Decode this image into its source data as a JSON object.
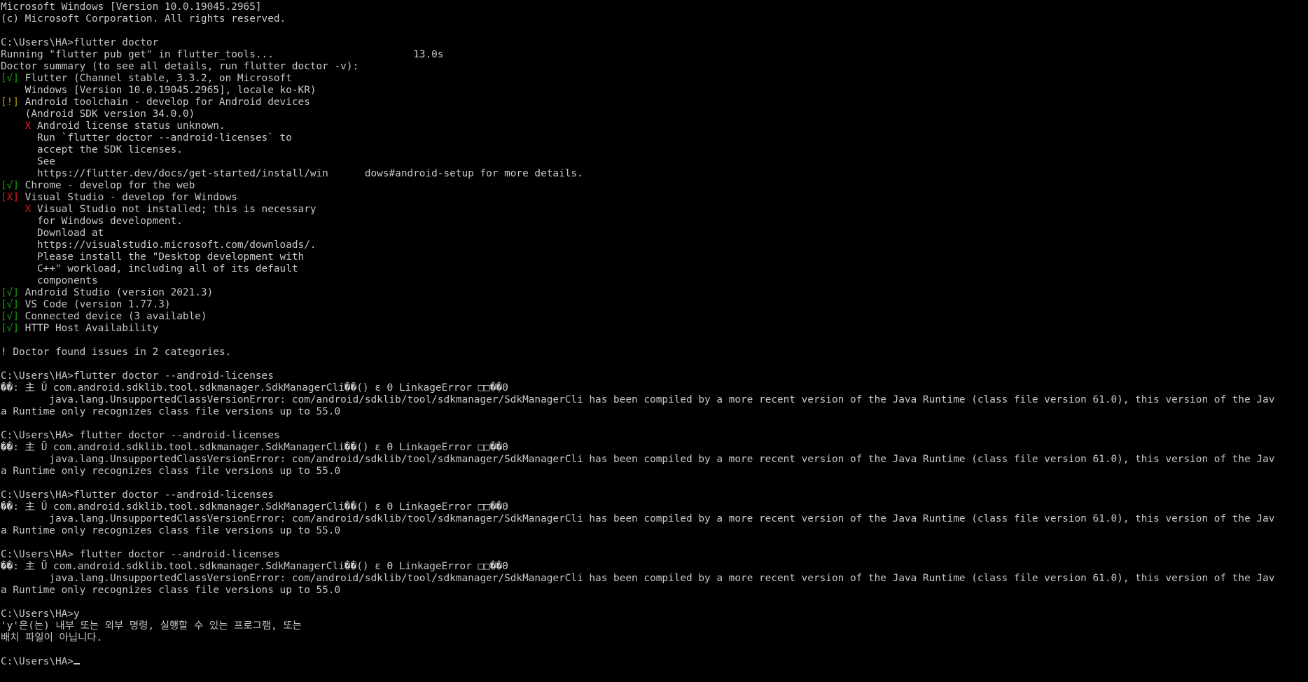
{
  "window": {
    "background": "#000000",
    "foreground": "#c8c8c8",
    "status_colors": {
      "ok": "#13a10e",
      "warning": "#c19c00",
      "error": "#e0181e"
    }
  },
  "console": {
    "lines": [
      {
        "parts": [
          {
            "t": "Microsoft Windows [Version 10.0.19045.2965]"
          }
        ]
      },
      {
        "parts": [
          {
            "t": "(c) Microsoft Corporation. All rights reserved."
          }
        ]
      },
      {
        "parts": [
          {
            "t": ""
          }
        ]
      },
      {
        "parts": [
          {
            "t": "C:\\Users\\HA>flutter doctor"
          }
        ]
      },
      {
        "parts": [
          {
            "t": "Running \"flutter pub get\" in flutter_tools...                       13.0s"
          }
        ]
      },
      {
        "parts": [
          {
            "t": "Doctor summary (to see all details, run flutter doctor -v):"
          }
        ]
      },
      {
        "parts": [
          {
            "t": "[√]",
            "c": "green"
          },
          {
            "t": " Flutter (Channel stable, 3.3.2, on Microsoft"
          }
        ]
      },
      {
        "parts": [
          {
            "t": "    Windows [Version 10.0.19045.2965], locale ko-KR)"
          }
        ]
      },
      {
        "parts": [
          {
            "t": "[!]",
            "c": "yellow"
          },
          {
            "t": " Android toolchain - develop for Android devices"
          }
        ]
      },
      {
        "parts": [
          {
            "t": "    (Android SDK version 34.0.0)"
          }
        ]
      },
      {
        "parts": [
          {
            "t": "    "
          },
          {
            "t": "X",
            "c": "red"
          },
          {
            "t": " Android license status unknown."
          }
        ]
      },
      {
        "parts": [
          {
            "t": "      Run `flutter doctor --android-licenses` to"
          }
        ]
      },
      {
        "parts": [
          {
            "t": "      accept the SDK licenses."
          }
        ]
      },
      {
        "parts": [
          {
            "t": "      See"
          }
        ]
      },
      {
        "parts": [
          {
            "t": "      https://flutter.dev/docs/get-started/install/win      dows#android-setup for more details."
          }
        ]
      },
      {
        "parts": [
          {
            "t": "[√]",
            "c": "green"
          },
          {
            "t": " Chrome - develop for the web"
          }
        ]
      },
      {
        "parts": [
          {
            "t": "[X]",
            "c": "red"
          },
          {
            "t": " Visual Studio - develop for Windows"
          }
        ]
      },
      {
        "parts": [
          {
            "t": "    "
          },
          {
            "t": "X",
            "c": "red"
          },
          {
            "t": " Visual Studio not installed; this is necessary"
          }
        ]
      },
      {
        "parts": [
          {
            "t": "      for Windows development."
          }
        ]
      },
      {
        "parts": [
          {
            "t": "      Download at"
          }
        ]
      },
      {
        "parts": [
          {
            "t": "      https://visualstudio.microsoft.com/downloads/."
          }
        ]
      },
      {
        "parts": [
          {
            "t": "      Please install the \"Desktop development with"
          }
        ]
      },
      {
        "parts": [
          {
            "t": "      C++\" workload, including all of its default"
          }
        ]
      },
      {
        "parts": [
          {
            "t": "      components"
          }
        ]
      },
      {
        "parts": [
          {
            "t": "[√]",
            "c": "green"
          },
          {
            "t": " Android Studio (version 2021.3)"
          }
        ]
      },
      {
        "parts": [
          {
            "t": "[√]",
            "c": "green"
          },
          {
            "t": " VS Code (version 1.77.3)"
          }
        ]
      },
      {
        "parts": [
          {
            "t": "[√]",
            "c": "green"
          },
          {
            "t": " Connected device (3 available)"
          }
        ]
      },
      {
        "parts": [
          {
            "t": "[√]",
            "c": "green"
          },
          {
            "t": " HTTP Host Availability"
          }
        ]
      },
      {
        "parts": [
          {
            "t": ""
          }
        ]
      },
      {
        "parts": [
          {
            "t": "! Doctor found issues in 2 categories."
          }
        ]
      },
      {
        "parts": [
          {
            "t": ""
          }
        ]
      },
      {
        "parts": [
          {
            "t": "C:\\Users\\HA>flutter doctor --android-licenses"
          }
        ]
      },
      {
        "parts": [
          {
            "t": "��: 主 Ŭ com.android.sdklib.tool.sdkmanager.SdkManagerCli��() ε Θ LinkageError □□��Θ"
          }
        ]
      },
      {
        "parts": [
          {
            "t": "        java.lang.UnsupportedClassVersionError: com/android/sdklib/tool/sdkmanager/SdkManagerCli has been compiled by a more recent version of the Java Runtime (class file version 61.0), this version of the Jav"
          }
        ]
      },
      {
        "parts": [
          {
            "t": "a Runtime only recognizes class file versions up to 55.0"
          }
        ]
      },
      {
        "parts": [
          {
            "t": ""
          }
        ]
      },
      {
        "parts": [
          {
            "t": "C:\\Users\\HA> flutter doctor --android-licenses"
          }
        ]
      },
      {
        "parts": [
          {
            "t": "��: 主 Ŭ com.android.sdklib.tool.sdkmanager.SdkManagerCli��() ε Θ LinkageError □□��Θ"
          }
        ]
      },
      {
        "parts": [
          {
            "t": "        java.lang.UnsupportedClassVersionError: com/android/sdklib/tool/sdkmanager/SdkManagerCli has been compiled by a more recent version of the Java Runtime (class file version 61.0), this version of the Jav"
          }
        ]
      },
      {
        "parts": [
          {
            "t": "a Runtime only recognizes class file versions up to 55.0"
          }
        ]
      },
      {
        "parts": [
          {
            "t": ""
          }
        ]
      },
      {
        "parts": [
          {
            "t": "C:\\Users\\HA>flutter doctor --android-licenses"
          }
        ]
      },
      {
        "parts": [
          {
            "t": "��: 主 Ŭ com.android.sdklib.tool.sdkmanager.SdkManagerCli��() ε Θ LinkageError □□��Θ"
          }
        ]
      },
      {
        "parts": [
          {
            "t": "        java.lang.UnsupportedClassVersionError: com/android/sdklib/tool/sdkmanager/SdkManagerCli has been compiled by a more recent version of the Java Runtime (class file version 61.0), this version of the Jav"
          }
        ]
      },
      {
        "parts": [
          {
            "t": "a Runtime only recognizes class file versions up to 55.0"
          }
        ]
      },
      {
        "parts": [
          {
            "t": ""
          }
        ]
      },
      {
        "parts": [
          {
            "t": "C:\\Users\\HA> flutter doctor --android-licenses"
          }
        ]
      },
      {
        "parts": [
          {
            "t": "��: 主 Ŭ com.android.sdklib.tool.sdkmanager.SdkManagerCli��() ε Θ LinkageError □□��Θ"
          }
        ]
      },
      {
        "parts": [
          {
            "t": "        java.lang.UnsupportedClassVersionError: com/android/sdklib/tool/sdkmanager/SdkManagerCli has been compiled by a more recent version of the Java Runtime (class file version 61.0), this version of the Jav"
          }
        ]
      },
      {
        "parts": [
          {
            "t": "a Runtime only recognizes class file versions up to 55.0"
          }
        ]
      },
      {
        "parts": [
          {
            "t": ""
          }
        ]
      },
      {
        "parts": [
          {
            "t": "C:\\Users\\HA>y"
          }
        ]
      },
      {
        "parts": [
          {
            "t": "'y'은(는) 내부 또는 외부 명령, 실행할 수 있는 프로그램, 또는"
          }
        ]
      },
      {
        "parts": [
          {
            "t": "배치 파일이 아닙니다."
          }
        ]
      },
      {
        "parts": [
          {
            "t": ""
          }
        ]
      },
      {
        "parts": [
          {
            "t": "C:\\Users\\HA>"
          }
        ],
        "prompt": true
      }
    ]
  }
}
